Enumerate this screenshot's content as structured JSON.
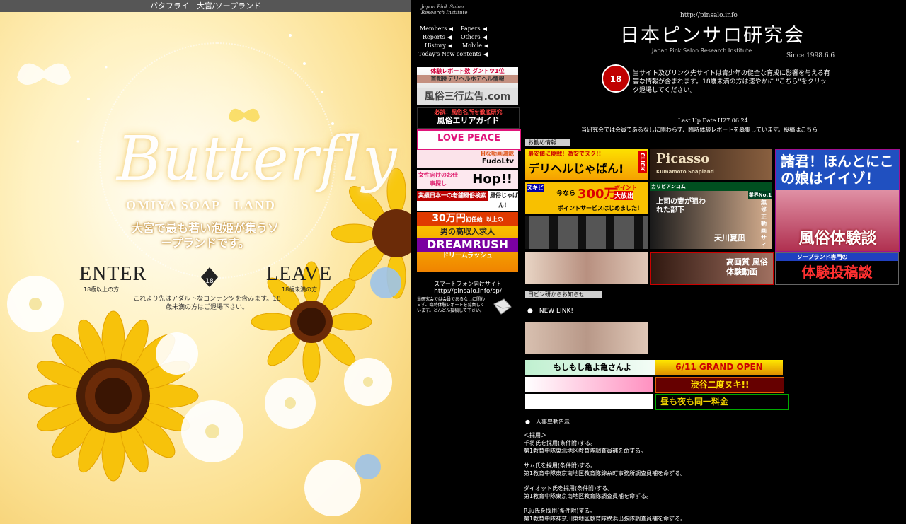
{
  "left": {
    "topbar": "バタフライ　大宮/ソープランド",
    "logo": "Butterfly",
    "subtitle": "OMIYA SOAP　LAND",
    "tagline": "大宮で最も若い泡姫が集うソープランドです。",
    "enter_label": "ENTER",
    "enter_sub": "18歳以上の方",
    "leave_label": "LEAVE",
    "leave_sub": "18歳未満の方",
    "notice": "これより先はアダルトなコンテンツを含みます。18歳未満の方はご退場下さい。",
    "badge": "18"
  },
  "right": {
    "jpsri": "Japan Pink Salon Research Institute",
    "nav": [
      "Members",
      "Papers",
      "Reports",
      "Others",
      "History",
      "Mobile",
      "Today's New contents"
    ],
    "url": "http://pinsalo.info",
    "title": "日本ピンサロ研究会",
    "title_sub": "Japan Pink Salon Research Institute",
    "since": "Since 1998.6.6",
    "warning": "当サイト及びリンク先サイトは青少年の健全な育成に影響を与える有害な情報が含まれます。18歳未満の方は速やかに \"こちら\"をクリック退場してください。",
    "last_update": "Last Up Date H27.06.24",
    "recruit": "当研究会では会員であるなしに関わらず、臨時体験レポートを募集しています。投稿はこちら",
    "side_ads": [
      "体験レポート数 ダントツ1位",
      "首都圏デリヘルホテヘル情報",
      "風俗三行広告.com",
      "必読！風俗名所を徹底研究",
      "風俗エリアガイド",
      "LOVE PEACE",
      "Hな動画満載",
      "FudoLtv",
      "女性向けのお仕事探し",
      "Hop!!",
      "実績日本一の老舗風俗検索",
      "風俗じゃぱん！",
      "30万円",
      "初任給",
      "以上の",
      "男の高収入求人",
      "DREAMRUSH",
      "ドリームラッシュ"
    ],
    "smartphone_label": "スマートフォン向けサイト",
    "smartphone_url": "http://pinsalo.info/sp/",
    "smartphone_desc": "当研究会では会員であるなしに関わらず、臨時体験レポートを募集しています。どんどん投稿して下さい。",
    "section_recommend": "お勧め情報",
    "ads": {
      "deli_top": "最安値に挑戦！激安でヌク!!",
      "deli": "デリヘルじゃぱん!",
      "click": "CLICK",
      "picasso": "Picasso",
      "picasso_sub": "Kumamoto Soapland",
      "shokun": "諸君！ほんとにこの娘はイイゾ！",
      "taiken": "風俗体験談",
      "nukibi": "ヌキビ",
      "ima": "今なら",
      "point": "300万",
      "point_unit": "ポイント",
      "daihoshutsu": "大放出",
      "point_sub": "ポイントサービスはじめました！",
      "kariya": "カリビアンコム",
      "joushi": "上司の妻が狙われた部下",
      "amakawa": "天川夏凪",
      "muryou": "無修正動画サイト",
      "gyokai": "業界No.1",
      "hd": "高画質 風俗体験動画",
      "soap_sub": "ソープランド専門の",
      "soap": "体験投稿談"
    },
    "section_news": "日ピン研からお知らせ",
    "new_link": "NEW LINK!",
    "banners": [
      "もしもし亀よ亀さんよ",
      "6/11 GRAND OPEN",
      "渋谷二度ヌキ!!",
      "昼も夜も同一料金"
    ],
    "personnel_title": "人事異動告示",
    "personnel": [
      "＜採用＞",
      "千将氏を採用(条件附)する。",
      "第1教育中隊東北地区教育隊調査員補を命ずる。",
      "サム氏を採用(条件附)する。",
      "第1教育中隊東京南地区教育隊錦糸町事務所調査員補を命ずる。",
      "ダイオット氏を採用(条件附)する。",
      "第1教育中隊東京南地区教育隊調査員補を命ずる。",
      "R.ju氏を採用(条件附)する。",
      "第1教育中隊神奈川東地区教育隊横浜出張隊調査員補を命ずる。"
    ]
  }
}
